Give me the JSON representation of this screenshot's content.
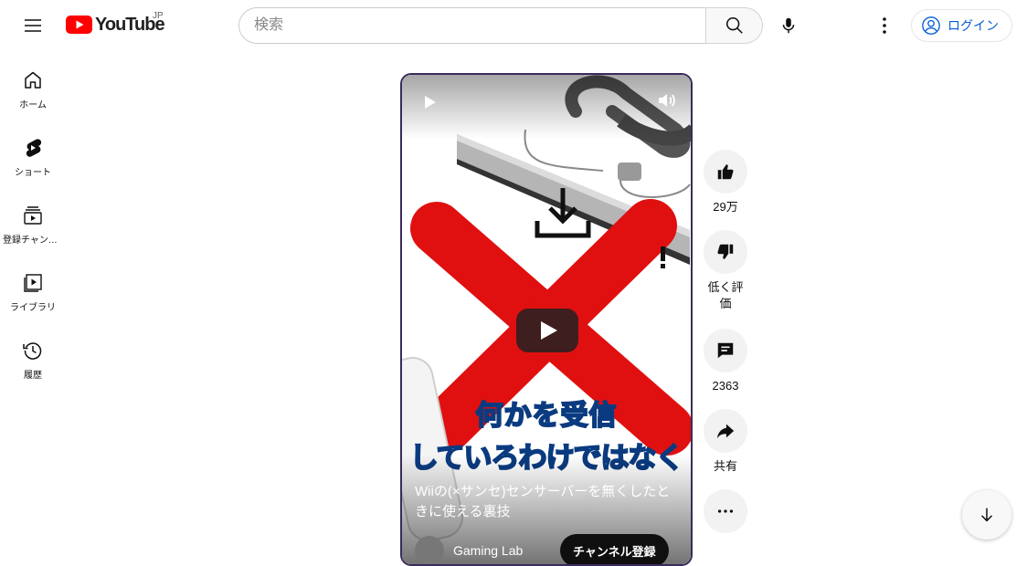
{
  "header": {
    "logo_text": "YouTube",
    "country_code": "JP",
    "search_placeholder": "検索",
    "login_label": "ログイン"
  },
  "sidebar": {
    "items": [
      {
        "label": "ホーム",
        "icon": "home-icon"
      },
      {
        "label": "ショート",
        "icon": "shorts-icon"
      },
      {
        "label": "登録チャンネル",
        "icon": "subscriptions-icon"
      },
      {
        "label": "ライブラリ",
        "icon": "library-icon"
      },
      {
        "label": "履歴",
        "icon": "history-icon"
      }
    ]
  },
  "short": {
    "overlay_line1": "何かを受信",
    "overlay_line2": "していろわけではなく",
    "title": "Wiiの(×サンセ)センサーバーを無くしたときに使える裏技",
    "channel_name": "Gaming Lab",
    "subscribe_label": "チャンネル登録"
  },
  "actions": {
    "like_count": "29万",
    "dislike_label": "低く評価",
    "comment_count": "2363",
    "share_label": "共有"
  },
  "colors": {
    "brand_red": "#ff0000",
    "link_blue": "#065fd4",
    "x_red": "#e01010",
    "overlay_text": "#4fc3f7"
  }
}
